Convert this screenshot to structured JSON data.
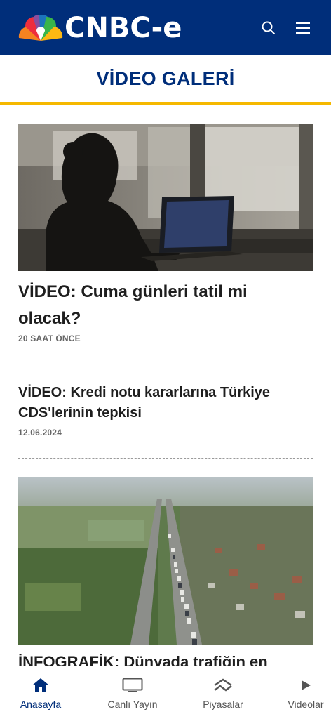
{
  "header": {
    "logo_text": "CNBC-e",
    "search_icon": "search-icon",
    "menu_icon": "hamburger-menu-icon"
  },
  "section": {
    "title": "VİDEO GALERİ"
  },
  "articles": [
    {
      "title": "VİDEO: Cuma günleri tatil mi olacak?",
      "date": "20 SAAT ÖNCE",
      "image": "woman-silhouette-laptop-photo"
    },
    {
      "title": "VİDEO: Kredi notu kararlarına Türkiye CDS'lerinin tepkisi",
      "date": "12.06.2024"
    },
    {
      "title": "İNFOGRAFİK: Dünyada trafiğin en",
      "image": "aerial-highway-traffic-photo"
    }
  ],
  "bottom_nav": [
    {
      "label": "Anasayfa",
      "icon": "home-icon",
      "active": true
    },
    {
      "label": "Canlı Yayın",
      "icon": "tv-icon",
      "active": false
    },
    {
      "label": "Piyasalar",
      "icon": "chart-chevron-icon",
      "active": false
    },
    {
      "label": "Videolar",
      "icon": "play-icon",
      "active": false
    }
  ],
  "colors": {
    "brand_blue": "#002e7a",
    "accent_yellow": "#f5b800"
  }
}
